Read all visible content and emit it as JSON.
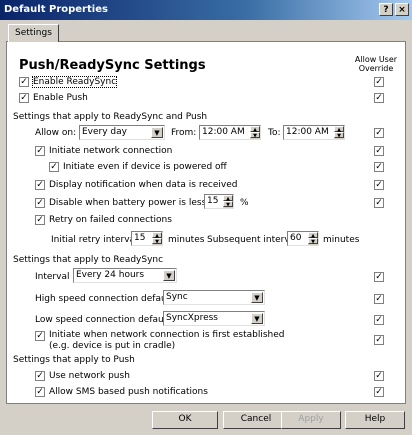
{
  "window": {
    "title": "Default Properties",
    "help_label": "?",
    "close_label": "×"
  },
  "tabs": {
    "settings": "Settings"
  },
  "header": {
    "title": "Push/ReadySync Settings",
    "override_line1": "Allow User",
    "override_line2": "Override"
  },
  "options": {
    "enable_readysync": {
      "label": "Enable ReadySync",
      "checked": true,
      "override": true
    },
    "enable_push": {
      "label": "Enable Push",
      "checked": true,
      "override": true
    }
  },
  "section_both": {
    "title": "Settings that apply to ReadySync and Push",
    "allow_on_label": "Allow on:",
    "allow_on_value": "Every day",
    "from_label": "From:",
    "from_value": "12:00 AM",
    "to_label": "To:",
    "to_value": "12:00 AM",
    "initiate_network": "Initiate network connection",
    "initiate_powered_off": "Initiate even if device is powered off",
    "display_notification": "Display notification when data is received",
    "disable_battery": "Disable when battery power is less than",
    "battery_value": "15",
    "battery_unit": "%",
    "retry_failed": "Retry on failed connections",
    "initial_retry_label": "Initial retry interval",
    "initial_retry_value": "15",
    "minutes_1": "minutes",
    "subsequent_label": "Subsequent interval",
    "subsequent_value": "60",
    "minutes_2": "minutes"
  },
  "section_readysync": {
    "title": "Settings that apply to ReadySync",
    "interval_label": "Interval",
    "interval_value": "Every 24 hours",
    "high_speed_label": "High speed connection default:",
    "high_speed_value": "Sync",
    "low_speed_label": "Low speed connection default:",
    "low_speed_value": "SyncXpress",
    "initiate_established_line1": "Initiate when network connection is first established",
    "initiate_established_line2": "(e.g. device is put in cradle)"
  },
  "section_push": {
    "title": "Settings that apply to Push",
    "use_network_push": "Use network push",
    "allow_sms": "Allow SMS based push notifications"
  },
  "buttons": {
    "ok": "OK",
    "cancel": "Cancel",
    "apply": "Apply",
    "help": "Help"
  },
  "colors": {
    "titlebar_start": "#0a246a",
    "titlebar_end": "#a6caf0",
    "dialog_bg": "#d4d0c8"
  }
}
